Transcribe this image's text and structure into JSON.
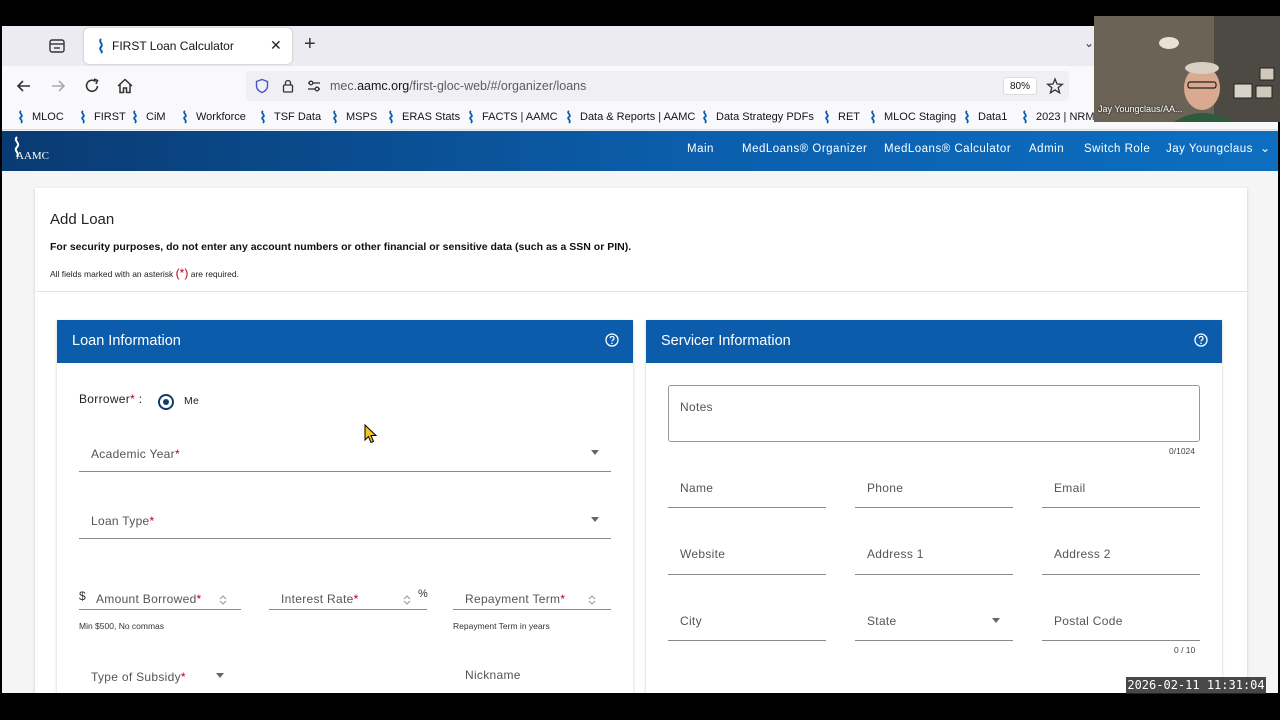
{
  "browser": {
    "tab_title": "FIRST Loan Calculator",
    "url_prefix": "mec.",
    "url_domain": "aamc.org",
    "url_path": "/first-gloc-web/#/organizer/loans",
    "zoom": "80%",
    "bookmarks": [
      "MLOC",
      "FIRST",
      "CiM",
      "Workforce",
      "TSF Data",
      "MSPS",
      "ERAS Stats",
      "FACTS | AAMC",
      "Data & Reports | AAMC",
      "Data Strategy PDFs",
      "RET",
      "MLOC Staging",
      "Data1",
      "2023 | NRM"
    ]
  },
  "app": {
    "logo_text": "AAMC",
    "nav": [
      "Main",
      "MedLoans® Organizer",
      "MedLoans® Calculator",
      "Admin",
      "Switch Role",
      "Jay Youngclaus"
    ]
  },
  "page": {
    "title": "Add Loan",
    "security_notice": "For security purposes, do not enter any account numbers or other financial or sensitive data (such as a SSN or PIN).",
    "required_prefix": "All fields marked with an asterisk",
    "required_asterisk": "(*)",
    "required_suffix": "are required."
  },
  "loan_panel": {
    "title": "Loan Information",
    "borrower_label": "Borrower",
    "borrower_colon": ":",
    "borrower_option": "Me",
    "academic_year": "Academic Year",
    "loan_type": "Loan Type",
    "currency_symbol": "$",
    "amount_borrowed": "Amount Borrowed",
    "amount_hint": "Min $500, No commas",
    "interest_rate": "Interest Rate",
    "percent_symbol": "%",
    "repayment_term": "Repayment Term",
    "repayment_hint": "Repayment Term in years",
    "subsidy": "Type of Subsidy",
    "nickname": "Nickname",
    "asterisk": "*"
  },
  "servicer_panel": {
    "title": "Servicer Information",
    "notes": "Notes",
    "notes_counter": "0/1024",
    "name": "Name",
    "phone": "Phone",
    "email": "Email",
    "website": "Website",
    "address1": "Address 1",
    "address2": "Address 2",
    "city": "City",
    "state": "State",
    "postal_code": "Postal Code",
    "postal_counter": "0 / 10"
  },
  "overlay": {
    "cam_name": "Jay Youngclaus/AA...",
    "timestamp": "2026-02-11 11:31:04"
  },
  "colors": {
    "header_blue": "#0b5cab",
    "required_red": "#b00020"
  }
}
